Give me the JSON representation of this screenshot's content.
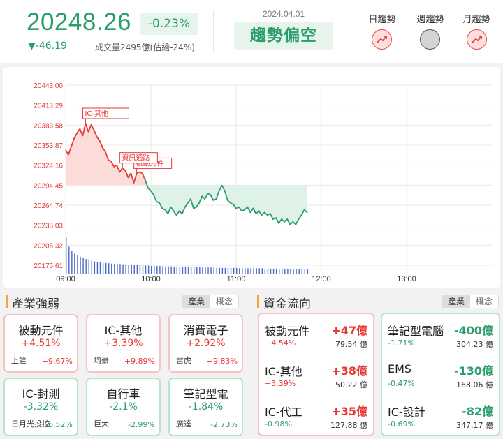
{
  "index": {
    "price": "20248.26",
    "change_pct": "-0.23%",
    "change": "▼-46.19",
    "volume": "成交量2495億(估繪-24%)"
  },
  "summary": {
    "date": "2024.04.01",
    "trend_label": "趨勢偏空"
  },
  "trends": [
    {
      "label": "日趨勢",
      "state": "up"
    },
    {
      "label": "週趨勢",
      "state": "flat"
    },
    {
      "label": "月趨勢",
      "state": "up"
    }
  ],
  "chart_data": {
    "type": "line",
    "reference": 20294.45,
    "ylim": [
      20175.61,
      20443.0
    ],
    "y_ticks": [
      "20443.00",
      "20413.29",
      "20383.58",
      "20353.87",
      "20324.16",
      "20294.45",
      "20264.74",
      "20235.03",
      "20205.32",
      "20175.61"
    ],
    "x_ticks": [
      "09:00",
      "10:00",
      "11:00",
      "12:00",
      "13:00"
    ],
    "session_minutes": 300,
    "series": [
      {
        "minutes": [
          0,
          2,
          4,
          6,
          8,
          10,
          12,
          14,
          16,
          18,
          20,
          22,
          24,
          26,
          28,
          30,
          32,
          34,
          36,
          38,
          40,
          42,
          44,
          46,
          48,
          50,
          52,
          54,
          56,
          58,
          60,
          62,
          64,
          66,
          68,
          70,
          72,
          74,
          76,
          78,
          80,
          82,
          84,
          86,
          88,
          90,
          92,
          94,
          96,
          98,
          100,
          102,
          104,
          106,
          108,
          110,
          112,
          114,
          116,
          118,
          120,
          122,
          124,
          126,
          128,
          130,
          132,
          134,
          136,
          138,
          140,
          142,
          144,
          146,
          148,
          150,
          152,
          154,
          156,
          158,
          160,
          162,
          164,
          166,
          168,
          170
        ],
        "values": [
          20346,
          20340,
          20352,
          20364,
          20372,
          20378,
          20368,
          20386,
          20374,
          20384,
          20376,
          20366,
          20360,
          20350,
          20344,
          20332,
          20330,
          20322,
          20324,
          20314,
          20320,
          20316,
          20306,
          20312,
          20298,
          20312,
          20314,
          20312,
          20302,
          20290,
          20286,
          20280,
          20270,
          20268,
          20260,
          20258,
          20252,
          20262,
          20256,
          20250,
          20256,
          20252,
          20262,
          20268,
          20274,
          20260,
          20262,
          20268,
          20278,
          20274,
          20282,
          20280,
          20272,
          20274,
          20286,
          20294,
          20286,
          20272,
          20268,
          20266,
          20260,
          20262,
          20256,
          20258,
          20262,
          20254,
          20260,
          20252,
          20256,
          20250,
          20254,
          20250,
          20252,
          20244,
          20246,
          20238,
          20244,
          20240,
          20244,
          20236,
          20240,
          20236,
          20244,
          20250,
          20258,
          20254
        ]
      }
    ],
    "volume": [
      95,
      70,
      60,
      52,
      48,
      44,
      40,
      38,
      36,
      34,
      32,
      30,
      30,
      28,
      28,
      27,
      26,
      26,
      25,
      25,
      24,
      24,
      23,
      23,
      22,
      22,
      22,
      21,
      21,
      21,
      20,
      20,
      20,
      20,
      19,
      19,
      19,
      19,
      18,
      18,
      18,
      18,
      18,
      17,
      17,
      17,
      17,
      17,
      16,
      16,
      16,
      16,
      16,
      16,
      15,
      15,
      15,
      15,
      15,
      15,
      15,
      14,
      14,
      14,
      14,
      14,
      14,
      14,
      14,
      14,
      13,
      13,
      13,
      13,
      13,
      13,
      13,
      13,
      13,
      13,
      12,
      12,
      12,
      12,
      12,
      12
    ],
    "annotations": [
      {
        "text": "IC-其他",
        "minute": 14
      },
      {
        "text": "被動元件",
        "minute": 50
      },
      {
        "text": "資訊通路",
        "minute": 40
      }
    ]
  },
  "industry": {
    "title": "產業強弱",
    "tabs": [
      "產業",
      "概念"
    ],
    "cards": [
      {
        "name": "被動元件",
        "pct": "+4.51%",
        "stock": "上詮",
        "stock_pct": "+9.67%",
        "tone": "red"
      },
      {
        "name": "IC-其他",
        "pct": "+3.39%",
        "stock": "均豪",
        "stock_pct": "+9.89%",
        "tone": "red"
      },
      {
        "name": "消費電子",
        "pct": "+2.92%",
        "stock": "雷虎",
        "stock_pct": "+9.83%",
        "tone": "red"
      },
      {
        "name": "IC-封測",
        "pct": "-3.32%",
        "stock": "日月光投控",
        "stock_pct": "-6.52%",
        "tone": "green"
      },
      {
        "name": "自行車",
        "pct": "-2.1%",
        "stock": "巨大",
        "stock_pct": "-2.99%",
        "tone": "green"
      },
      {
        "name": "筆記型電",
        "pct": "-1.84%",
        "stock": "廣達",
        "stock_pct": "-2.73%",
        "tone": "green"
      }
    ]
  },
  "fund_flow": {
    "title": "資金流向",
    "tabs": [
      "產業",
      "概念"
    ],
    "inflow": [
      {
        "name": "被動元件",
        "value": "+47億",
        "pct": "+4.54%",
        "amount": "79.54 億"
      },
      {
        "name": "IC-其他",
        "value": "+38億",
        "pct": "+3.39%",
        "amount": "50.22 億"
      },
      {
        "name": "IC-代工",
        "value": "+35億",
        "pct": "-0.98%",
        "amount": "127.88 億"
      }
    ],
    "outflow": [
      {
        "name": "筆記型電腦",
        "value": "-400億",
        "pct": "-1.71%",
        "amount": "304.23 億"
      },
      {
        "name": "EMS",
        "value": "-130億",
        "pct": "-0.47%",
        "amount": "168.06 億"
      },
      {
        "name": "IC-設計",
        "value": "-82億",
        "pct": "-0.69%",
        "amount": "347.17 億"
      }
    ]
  },
  "colors": {
    "up": "#e53935",
    "down": "#2a9d6c",
    "accent": "#f4a340"
  }
}
